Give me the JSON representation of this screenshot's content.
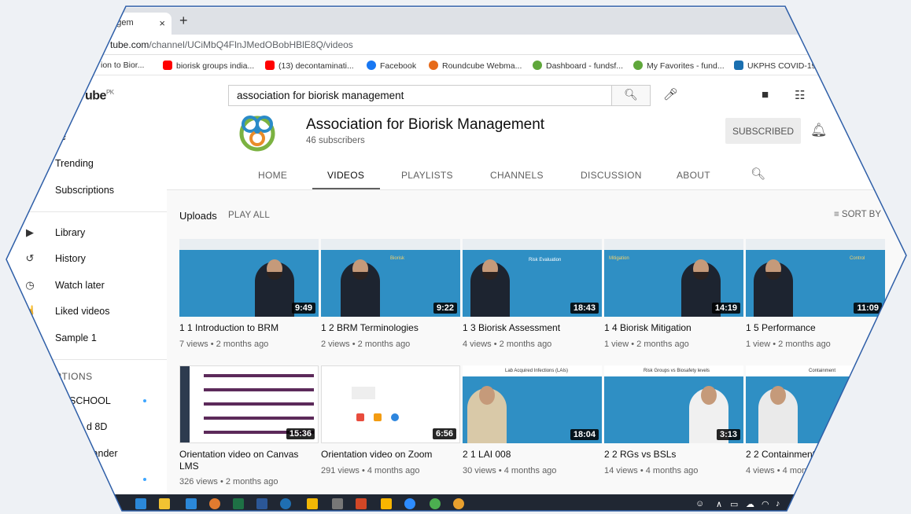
{
  "browser": {
    "tab_title": "nagem",
    "tab_close": "×",
    "new_tab": "+",
    "url_host": "tube.com",
    "url_path": "/channel/UCiMbQ4FlnJMedOBobHBlE8Q/videos",
    "bookmarks": [
      {
        "label": "ion to Bior...",
        "color": "#4a90d9"
      },
      {
        "label": "biorisk groups india...",
        "color": "#ff0000"
      },
      {
        "label": "(13) decontaminati...",
        "color": "#ff0000"
      },
      {
        "label": "Facebook",
        "color": "#1877f2"
      },
      {
        "label": "Roundcube Webma...",
        "color": "#e66a1a"
      },
      {
        "label": "Dashboard - fundsf...",
        "color": "#5fa73b"
      },
      {
        "label": "My Favorites - fund...",
        "color": "#5fa73b"
      },
      {
        "label": "UKPHS COVID-19",
        "color": "#1a6fb0"
      }
    ]
  },
  "youtube": {
    "logo": "ube",
    "logo_region": "PK",
    "search_value": "association for biorisk management"
  },
  "sidebar": {
    "items": [
      {
        "label": "ne",
        "icon": "home-icon"
      },
      {
        "label": "Trending",
        "icon": "fire-icon"
      },
      {
        "label": "Subscriptions",
        "icon": "subscriptions-icon"
      },
      {
        "label": "Library",
        "icon": "library-icon"
      },
      {
        "label": "History",
        "icon": "history-icon"
      },
      {
        "label": "Watch later",
        "icon": "clock-icon"
      },
      {
        "label": "Liked videos",
        "icon": "thumb-up-icon"
      },
      {
        "label": "Sample 1",
        "icon": "playlist-icon"
      }
    ],
    "section_title": "PTIONS",
    "subscriptions": [
      "SCHOOL",
      "d 8D",
      "llander",
      ""
    ]
  },
  "channel": {
    "name": "Association for Biorisk Management",
    "subscribers": "46 subscribers",
    "subscribe_label": "SUBSCRIBED",
    "tabs": [
      "HOME",
      "VIDEOS",
      "PLAYLISTS",
      "CHANNELS",
      "DISCUSSION",
      "ABOUT"
    ],
    "active_tab": "VIDEOS"
  },
  "uploads": {
    "title": "Uploads",
    "play_all": "PLAY ALL",
    "sort_by": "SORT BY"
  },
  "videos": [
    {
      "title": "1 1 Introduction to BRM",
      "meta": "7 views • 2 months ago",
      "duration": "9:49",
      "slide": ""
    },
    {
      "title": "1 2 BRM Terminologies",
      "meta": "2 views • 2 months ago",
      "duration": "9:22",
      "slide": "Biorisk"
    },
    {
      "title": "1 3 Biorisk Assessment",
      "meta": "4 views • 2 months ago",
      "duration": "18:43",
      "slide": "Risk Evaluation"
    },
    {
      "title": "1 4 Biorisk Mitigation",
      "meta": "1 view • 2 months ago",
      "duration": "14:19",
      "slide": "Mitigation"
    },
    {
      "title": "1 5 Performance",
      "meta": "1 view • 2 months ago",
      "duration": "11:09",
      "slide": "Control"
    },
    {
      "title": "Orientation video on Canvas LMS",
      "meta": "326 views • 2 months ago",
      "duration": "15:36",
      "slide": ""
    },
    {
      "title": "Orientation video on Zoom",
      "meta": "291 views • 4 months ago",
      "duration": "6:56",
      "slide": ""
    },
    {
      "title": "2 1 LAI 008",
      "meta": "30 views • 4 months ago",
      "duration": "18:04",
      "slide": "Lab Acquired Infections (LAIs)"
    },
    {
      "title": "2 2 RGs vs BSLs",
      "meta": "14 views • 4 months ago",
      "duration": "3:13",
      "slide": "Risk Groups vs Biosafety levels"
    },
    {
      "title": "2 2 Containment",
      "meta": "4 views • 4 mon",
      "duration": "",
      "slide": "Containment"
    }
  ],
  "colors": {
    "slide_blue": "#2f8fc4",
    "yt_red": "#ff0000",
    "taskbar": "#202733"
  }
}
